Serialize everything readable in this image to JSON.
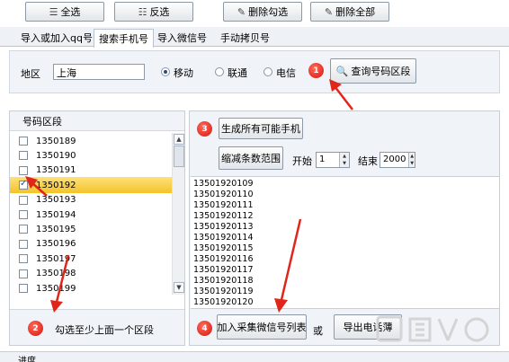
{
  "toolbar": {
    "select_all": "全选",
    "invert": "反选",
    "delete_checked": "删除勾选",
    "delete_all": "删除全部"
  },
  "tabs": [
    {
      "label": "导入或加入qq号",
      "active": false
    },
    {
      "label": "搜索手机号",
      "active": true
    },
    {
      "label": "导入微信号",
      "active": false
    },
    {
      "label": "手动拷贝号",
      "active": false
    }
  ],
  "filter": {
    "region_label": "地区",
    "region_value": "上海",
    "carriers": [
      {
        "label": "移动",
        "selected": true
      },
      {
        "label": "联通",
        "selected": false
      },
      {
        "label": "电信",
        "selected": false
      }
    ],
    "query_button": "查询号码区段"
  },
  "steps": [
    "1",
    "2",
    "3",
    "4"
  ],
  "left": {
    "header": "号码区段",
    "codes": [
      {
        "code": "1350189",
        "checked": false,
        "selected": false
      },
      {
        "code": "1350190",
        "checked": false,
        "selected": false
      },
      {
        "code": "1350191",
        "checked": false,
        "selected": false
      },
      {
        "code": "1350192",
        "checked": true,
        "selected": true
      },
      {
        "code": "1350193",
        "checked": false,
        "selected": false
      },
      {
        "code": "1350194",
        "checked": false,
        "selected": false
      },
      {
        "code": "1350195",
        "checked": false,
        "selected": false
      },
      {
        "code": "1350196",
        "checked": false,
        "selected": false
      },
      {
        "code": "1350197",
        "checked": false,
        "selected": false
      },
      {
        "code": "1350198",
        "checked": false,
        "selected": false
      },
      {
        "code": "1350199",
        "checked": false,
        "selected": false
      }
    ],
    "hint": "勾选至少上面一个区段"
  },
  "right": {
    "generate_button": "生成所有可能手机",
    "shrink_button": "缩减条数范围",
    "start_label": "开始",
    "start_value": "1",
    "end_label": "结束",
    "end_value": "2000",
    "phones": [
      "13501920109",
      "13501920110",
      "13501920111",
      "13501920112",
      "13501920113",
      "13501920114",
      "13501920115",
      "13501920116",
      "13501920117",
      "13501920118",
      "13501920119",
      "13501920120"
    ],
    "add_button": "加入采集微信号列表",
    "or_label": "或",
    "export_button": "导出电话薄"
  },
  "status": {
    "progress_label": "进度"
  },
  "colors": {
    "step_red": "#d8140c",
    "selection_yellow": "#f3c32a",
    "arrow_red": "#e0251b"
  }
}
